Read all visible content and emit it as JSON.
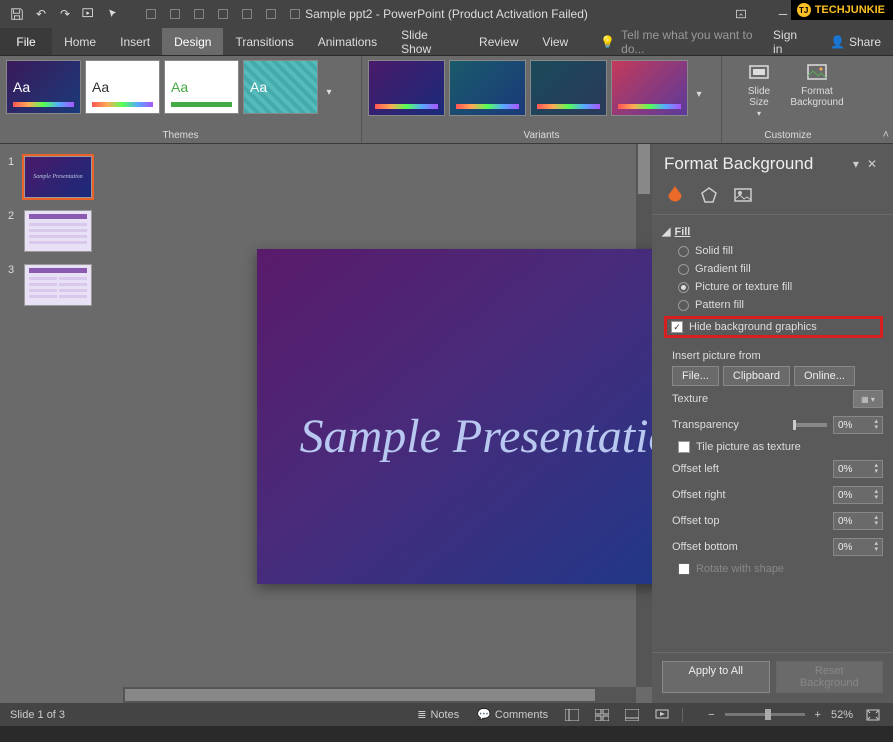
{
  "watermark": "TECHJUNKIE",
  "titlebar": {
    "title": "Sample ppt2 - PowerPoint (Product Activation Failed)"
  },
  "menubar": {
    "file": "File",
    "tabs": [
      "Home",
      "Insert",
      "Design",
      "Transitions",
      "Animations",
      "Slide Show",
      "Review",
      "View"
    ],
    "active_tab": "Design",
    "tellme": "Tell me what you want to do...",
    "signin": "Sign in",
    "share": "Share"
  },
  "ribbon": {
    "themes_label": "Themes",
    "variants_label": "Variants",
    "customize_label": "Customize",
    "theme_swatch_text": [
      "Aa",
      "Aa",
      "Aa",
      "Aa"
    ],
    "slide_size": "Slide\nSize",
    "format_bg": "Format\nBackground"
  },
  "thumbnails": {
    "slides": [
      "1",
      "2",
      "3"
    ],
    "slide1_text": "Sample Presentation"
  },
  "slide": {
    "title": "Sample Presentation"
  },
  "pane": {
    "title": "Format Background",
    "fill_label": "Fill",
    "solid_fill": "Solid fill",
    "gradient_fill": "Gradient fill",
    "picture_fill": "Picture or texture fill",
    "pattern_fill": "Pattern fill",
    "hide_bg": "Hide background graphics",
    "insert_from": "Insert picture from",
    "file_btn": "File...",
    "clipboard_btn": "Clipboard",
    "online_btn": "Online...",
    "texture": "Texture",
    "transparency": "Transparency",
    "transparency_val": "0%",
    "tile": "Tile picture as texture",
    "offset_left": "Offset left",
    "offset_right": "Offset right",
    "offset_top": "Offset top",
    "offset_bottom": "Offset bottom",
    "offset_val": "0%",
    "rotate": "Rotate with shape",
    "apply_all": "Apply to All",
    "reset": "Reset Background"
  },
  "statusbar": {
    "slide_info": "Slide 1 of 3",
    "notes": "Notes",
    "comments": "Comments",
    "zoom": "52%"
  }
}
